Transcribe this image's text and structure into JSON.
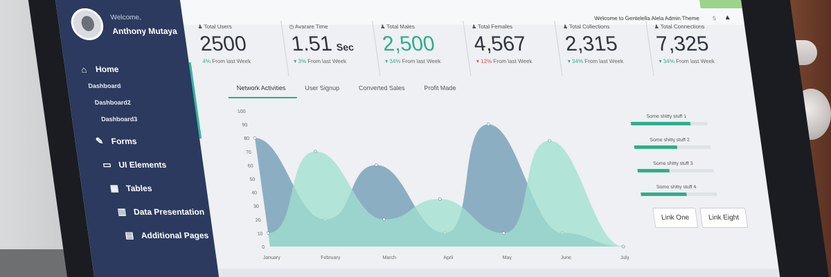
{
  "header": {
    "greeting": "Welcome to Gentelella Alela Admin Theme",
    "count": "5",
    "user_icon": "user-icon"
  },
  "profile": {
    "welcome": "Welcome,",
    "name": "Anthony Mutaya"
  },
  "sidebar": {
    "items": [
      {
        "icon": "home-icon",
        "label": "Home",
        "subitems": [
          "Dashboard",
          "Dashboard2",
          "Dashboard3"
        ]
      },
      {
        "icon": "edit-icon",
        "label": "Forms"
      },
      {
        "icon": "desktop-icon",
        "label": "UI Elements"
      },
      {
        "icon": "table-icon",
        "label": "Tables"
      },
      {
        "icon": "bar-chart-icon",
        "label": "Data Presentation"
      },
      {
        "icon": "layout-icon",
        "label": "Additional Pages"
      }
    ]
  },
  "stats": [
    {
      "label": "Total Users",
      "value": "2500",
      "unit": "",
      "change_pct": "4%",
      "change_text": "From last Week",
      "direction": "up"
    },
    {
      "label": "Avarare Time",
      "value": "1.51",
      "unit": "Sec",
      "change_pct": "3%",
      "change_text": "From last Week",
      "direction": "up"
    },
    {
      "label": "Total Males",
      "value": "2,500",
      "unit": "",
      "change_pct": "34%",
      "change_text": "From last Week",
      "direction": "up"
    },
    {
      "label": "Total Females",
      "value": "4,567",
      "unit": "",
      "change_pct": "12%",
      "change_text": "From last Week",
      "direction": "down"
    },
    {
      "label": "Total Collections",
      "value": "2,315",
      "unit": "",
      "change_pct": "34%",
      "change_text": "From last Week",
      "direction": "up"
    },
    {
      "label": "Total Connections",
      "value": "7,325",
      "unit": "",
      "change_pct": "34%",
      "change_text": "From last Week",
      "direction": "up"
    }
  ],
  "tabs": [
    "Network Activities",
    "User Signup",
    "Converted Sales",
    "Profit Made"
  ],
  "chart_data": {
    "type": "area",
    "x": [
      "January",
      "February",
      "March",
      "April",
      "May",
      "June",
      "July"
    ],
    "ylim": [
      0,
      100
    ],
    "yticks": [
      0,
      10,
      20,
      30,
      40,
      50,
      60,
      70,
      80,
      90,
      100
    ],
    "series": [
      {
        "color": "#7aa2b8",
        "values": [
          80,
          20,
          60,
          10,
          90,
          10,
          0
        ]
      },
      {
        "color": "#9fe0cf",
        "values": [
          10,
          70,
          20,
          35,
          10,
          78,
          0
        ]
      }
    ]
  },
  "legend": [
    {
      "label": "Some shitty stuff 1",
      "value": 0.78
    },
    {
      "label": "Some shitty stuff 2",
      "value": 0.56
    },
    {
      "label": "Some shitty stuff 3",
      "value": 0.42
    },
    {
      "label": "Some shitty stuff 4",
      "value": 0.6
    }
  ],
  "buttons": [
    "Link One",
    "Link Eight"
  ]
}
